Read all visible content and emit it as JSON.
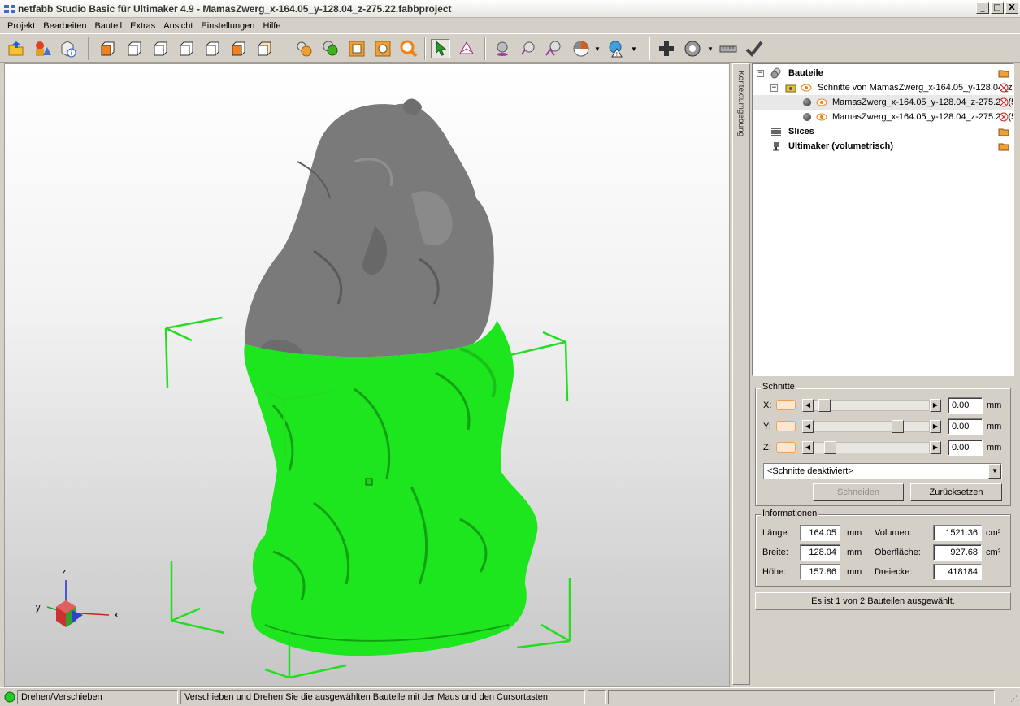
{
  "window": {
    "title": "netfabb Studio Basic für Ultimaker 4.9 - MamasZwerg_x-164.05_y-128.04_z-275.22.fabbproject",
    "minimize": "_",
    "maximize": "□",
    "close": "X"
  },
  "menu": [
    "Projekt",
    "Bearbeiten",
    "Bauteil",
    "Extras",
    "Ansicht",
    "Einstellungen",
    "Hilfe"
  ],
  "toolbar": {
    "icons": [
      "open-project-icon",
      "add-part-icon",
      "part-info-icon",
      "view-front-icon",
      "view-back-icon",
      "view-left-icon",
      "view-right-icon",
      "view-top-icon",
      "view-bottom-icon",
      "view-iso-icon",
      "zoom-selection-icon",
      "zoom-all-icon",
      "zoom-box-icon",
      "zoom-parts-icon",
      "zoom-magnifier-icon",
      "select-tool-icon",
      "rotate-tool-icon",
      "shaded-view-icon",
      "wireframe-view-icon",
      "transparent-view-icon",
      "display-mode-icon",
      "repair-icon",
      "add-part-plus-icon",
      "measure-icon",
      "ruler-icon",
      "checkmark-icon"
    ]
  },
  "viewport": {
    "axis_labels": {
      "x": "x",
      "y": "y",
      "z": "z"
    },
    "colors": {
      "part_grey": "#7a7a7a",
      "part_green": "#1ee61e",
      "bbox_green": "#22dd22"
    }
  },
  "sidetab": {
    "label": "Kontextumgebung"
  },
  "tree": {
    "root_parts": "Bauteile",
    "group": "Schnitte von MamasZwerg_x-164.05_y-128.04_z-",
    "part1": "MamasZwerg_x-164.05_y-128.04_z-275.22 (5",
    "part2": "MamasZwerg_x-164.05_y-128.04_z-275.22 (5",
    "slices": "Slices",
    "machine": "Ultimaker (volumetrisch)"
  },
  "cuts": {
    "title": "Schnitte",
    "rows": [
      {
        "axis": "X:",
        "value": "0.00",
        "unit": "mm",
        "position": 0.05
      },
      {
        "axis": "Y:",
        "value": "0.00",
        "unit": "mm",
        "position": 0.75
      },
      {
        "axis": "Z:",
        "value": "0.00",
        "unit": "mm",
        "position": 0.1
      }
    ],
    "mode": "<Schnitte deaktiviert>",
    "cut_button": "Schneiden",
    "reset_button": "Zurücksetzen"
  },
  "info": {
    "title": "Informationen",
    "length_label": "Länge:",
    "length": "164.05",
    "length_unit": "mm",
    "width_label": "Breite:",
    "width": "128.04",
    "width_unit": "mm",
    "height_label": "Höhe:",
    "height": "157.86",
    "height_unit": "mm",
    "volume_label": "Volumen:",
    "volume": "1521.36",
    "volume_unit": "cm³",
    "surface_label": "Oberfläche:",
    "surface": "927.68",
    "surface_unit": "cm²",
    "triangles_label": "Dreiecke:",
    "triangles": "418184"
  },
  "selection_status": "Es ist 1 von 2 Bauteilen ausgewählt.",
  "statusbar": {
    "mode": "Drehen/Verschieben",
    "hint": "Verschieben und Drehen Sie die ausgewählten Bauteile mit der Maus und den Cursortasten",
    "status_color": "#22cc22"
  }
}
